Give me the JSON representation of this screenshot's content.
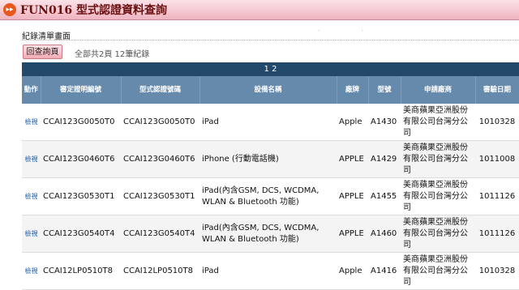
{
  "title": "FUN016 型式認證資料查詢",
  "section_label": "紀錄清單畫面",
  "back_button": "回查詢頁",
  "summary": "全部共2頁 12筆紀錄",
  "pager": "1 2",
  "columns": [
    "動作",
    "審定證明編號",
    "型式認證號碼",
    "設備名稱",
    "廠牌",
    "型號",
    "申請廠商",
    "審驗日期"
  ],
  "rows": [
    {
      "action": "檢視",
      "cert_no": "CCAI123G0050T0",
      "type_no": "CCAI123G0050T0",
      "device": "iPad",
      "brand": "Apple",
      "model": "A1430",
      "applicant": "美商蘋果亞洲股份有限公司台灣分公司",
      "date": "1010328"
    },
    {
      "action": "檢視",
      "cert_no": "CCAI123G0460T6",
      "type_no": "CCAI123G0460T6",
      "device": "iPhone (行動電話機)",
      "brand": "APPLE",
      "model": "A1429",
      "applicant": "美商蘋果亞洲股份有限公司台灣分公司",
      "date": "1011008"
    },
    {
      "action": "檢視",
      "cert_no": "CCAI123G0530T1",
      "type_no": "CCAI123G0530T1",
      "device": "iPad(內含GSM, DCS, WCDMA, WLAN & Bluetooth 功能)",
      "brand": "APPLE",
      "model": "A1455",
      "applicant": "美商蘋果亞洲股份有限公司台灣分公司",
      "date": "1011126"
    },
    {
      "action": "檢視",
      "cert_no": "CCAI123G0540T4",
      "type_no": "CCAI123G0540T4",
      "device": "iPad(內含GSM, DCS, WCDMA, WLAN & Bluetooth 功能)",
      "brand": "APPLE",
      "model": "A1460",
      "applicant": "美商蘋果亞洲股份有限公司台灣分公司",
      "date": "1011126"
    },
    {
      "action": "檢視",
      "cert_no": "CCAI12LP0510T8",
      "type_no": "CCAI12LP0510T8",
      "device": "iPad",
      "brand": "Apple",
      "model": "A1416",
      "applicant": "美商蘋果亞洲股份有限公司台灣分公司",
      "date": "1010328"
    }
  ]
}
